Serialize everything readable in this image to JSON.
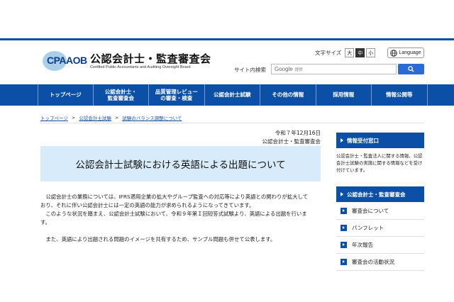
{
  "header": {
    "logo_text": "CPAAOB",
    "site_title": "公認会計士・監査審査会",
    "site_subtitle": "Certified Public Accountants and Auditing Oversight Board",
    "font_size_label": "文字サイズ",
    "font_sizes": [
      "大",
      "中",
      "小"
    ],
    "font_size_active": "中",
    "language_label": "Language",
    "search_label": "サイト内検索",
    "search_engine": "Google",
    "search_placeholder": "提供"
  },
  "nav": {
    "items": [
      {
        "label": "トップページ"
      },
      {
        "label": "公認会計士・\n監査審査会"
      },
      {
        "label": "品質管理レビュー\nの審査・検査"
      },
      {
        "label": "公認会計士試験"
      },
      {
        "label": "その他の情報"
      },
      {
        "label": "採用情報"
      },
      {
        "label": "情報公開等"
      }
    ]
  },
  "breadcrumb": {
    "items": [
      "トップページ",
      "公認会計士試験",
      "試験のバランス調整について"
    ],
    "separator": ">"
  },
  "main": {
    "date": "令和７年12月16日",
    "organization": "公認会計士・監査審査会",
    "title": "公認会計士試験における英語による出題について",
    "paragraphs": [
      "　公認会計士の業務については、IFRS適用企業の拡大やグループ監査への対応等により英語との関わりが拡大して",
      "おり、それに伴い公認会計士には一定の英語の能力が求められるようになってきています。",
      "　このような状況を踏まえ、公認会計士試験において、令和９年第Ｉ回短答式試験より、英語による出題を行いま",
      "す。",
      "　また、英語により出題される問題のイメージを共有するため、サンプル問題も併せて公表します。"
    ]
  },
  "sidebar": {
    "info_title": "情報受付窓口",
    "info_desc": "公認会計士・監査法人に関する情報、公認会計士試験の実施に関する情報などを受け付けています。",
    "about_title": "公認会計士・監査審査会",
    "about_items": [
      "審査会について",
      "パンフレット",
      "年次報告",
      "審査会の活動状況"
    ]
  },
  "colors": {
    "brand_blue": "#0b4fa6",
    "title_bg": "#d7ebfa",
    "search_button": "#2c6ad6"
  }
}
